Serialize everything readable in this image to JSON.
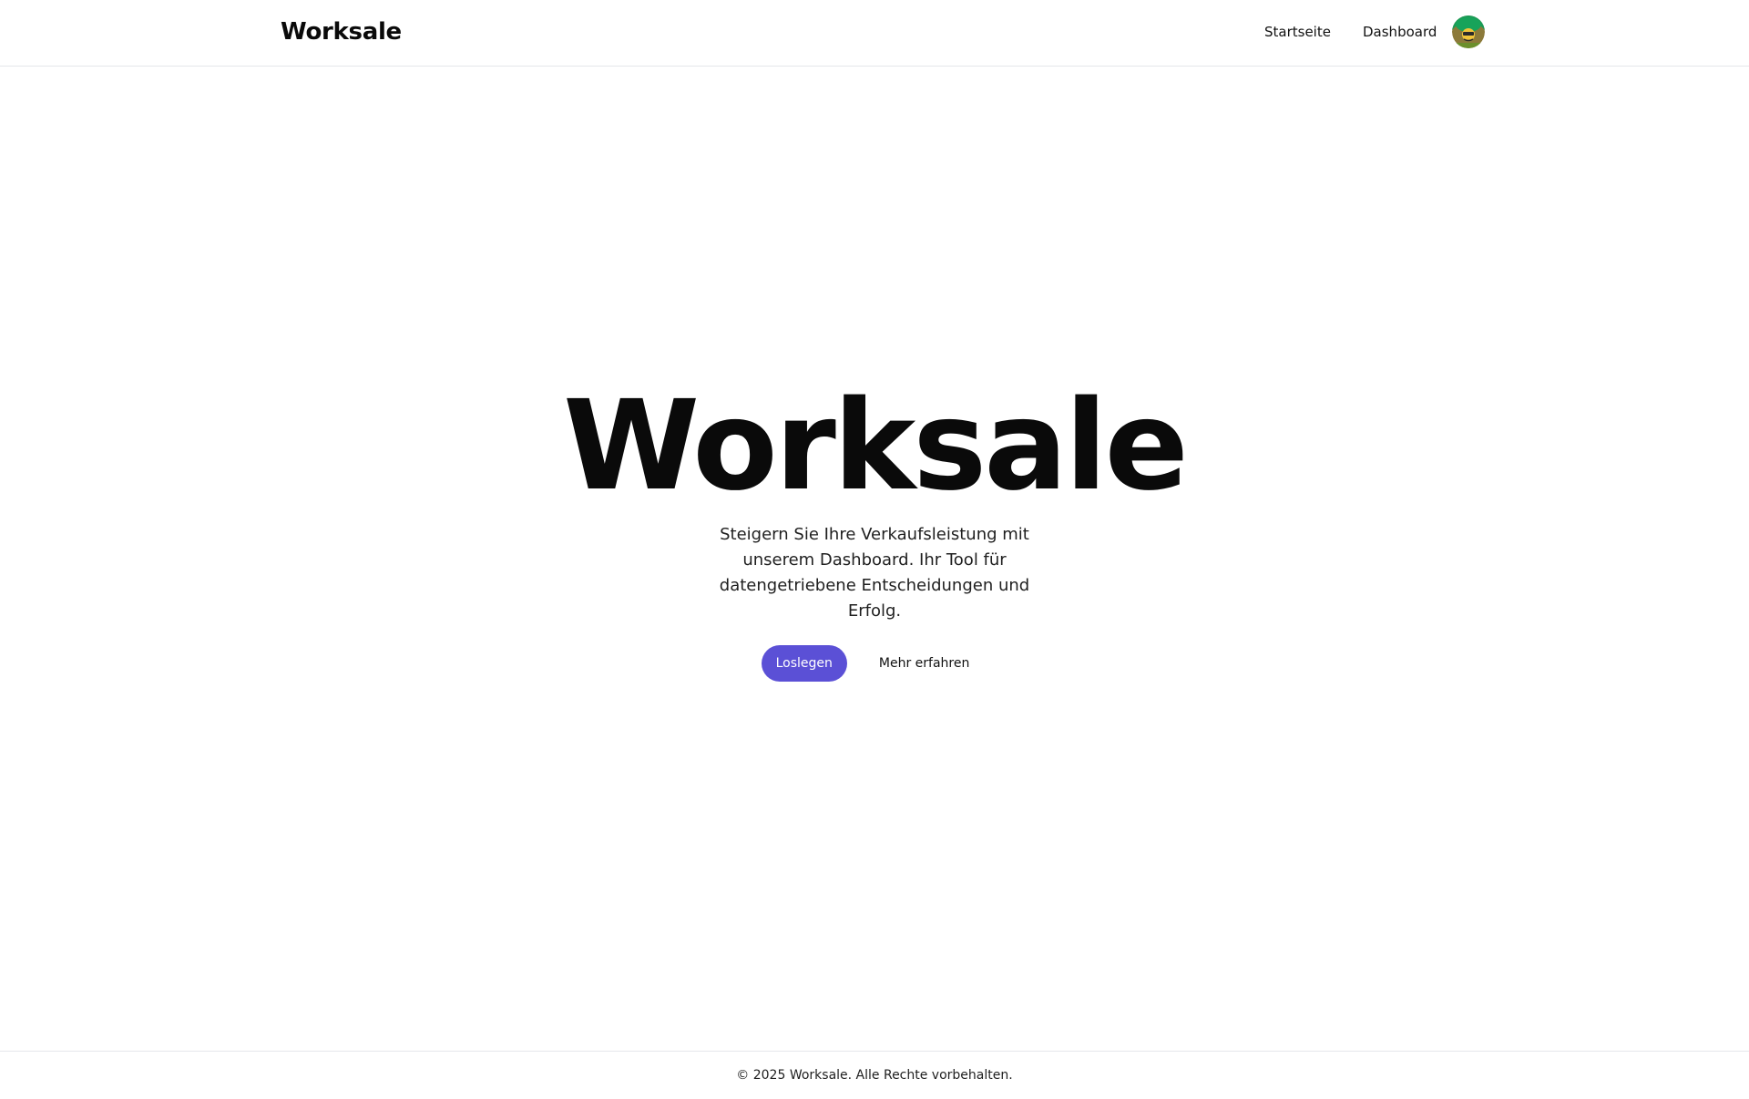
{
  "header": {
    "brand": "Worksale",
    "nav": {
      "home": "Startseite",
      "dashboard": "Dashboard"
    },
    "avatar_icon": "user-avatar-icon"
  },
  "hero": {
    "title": "Worksale",
    "subtitle": "Steigern Sie Ihre Verkaufsleistung mit unserem Dashboard. Ihr Tool für datengetriebene Entscheidungen und Erfolg.",
    "primary_button": "Loslegen",
    "secondary_button": "Mehr erfahren"
  },
  "footer": {
    "text": "© 2025 Worksale. Alle Rechte vorbehalten."
  },
  "colors": {
    "accent": "#5b50d6",
    "text": "#0a0a0a",
    "border": "#e5e7eb",
    "background": "#ffffff"
  }
}
